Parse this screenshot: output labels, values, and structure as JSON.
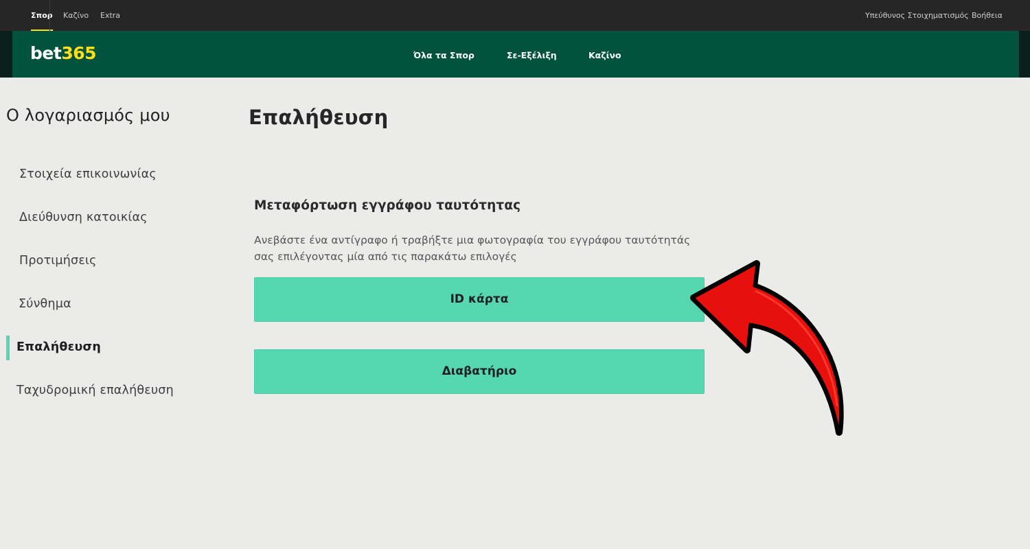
{
  "topbar": {
    "tabs": [
      {
        "label": "Σπορ",
        "active": true
      },
      {
        "label": "Καζίνο",
        "active": false
      },
      {
        "label": "Extra",
        "active": false
      }
    ],
    "right_links": [
      "Υπεύθυνος Στοιχηματισμός",
      "Βοήθεια"
    ]
  },
  "brand": {
    "logo_bet": "bet",
    "logo_num": "365",
    "nav": [
      "Όλα τα Σπορ",
      "Σε-Εξέλιξη",
      "Καζίνο"
    ]
  },
  "sidebar": {
    "heading": "Ο λογαριασμός μου",
    "items": [
      {
        "label": "Στοιχεία επικοινωνίας",
        "active": false
      },
      {
        "label": "Διεύθυνση κατοικίας",
        "active": false
      },
      {
        "label": "Προτιμήσεις",
        "active": false
      },
      {
        "label": "Σύνθημα",
        "active": false
      },
      {
        "label": "Επαλήθευση",
        "active": true
      },
      {
        "label": "Ταχυδρομική επαλήθευση",
        "active": false
      }
    ]
  },
  "main": {
    "title": "Επαλήθευση",
    "upload_title": "Μεταφόρτωση εγγράφου ταυτότητας",
    "upload_desc_line1": "Ανεβάστε ένα αντίγραφο ή τραβήξτε μια φωτογραφία του εγγράφου ταυτότητάς",
    "upload_desc_line2": "σας επιλέγοντας μία από τις παρακάτω επιλογές",
    "buttons": [
      "ID κάρτα",
      "Διαβατήριο"
    ]
  },
  "colors": {
    "topbar": "#262626",
    "brand_green": "#02533e",
    "accent_yellow": "#ffdf1b",
    "button_green": "#56d7b0",
    "page_bg": "#ebecea",
    "annotation_arrow": "#e8100c"
  },
  "annotation": {
    "icon": "red-curved-arrow-icon"
  }
}
